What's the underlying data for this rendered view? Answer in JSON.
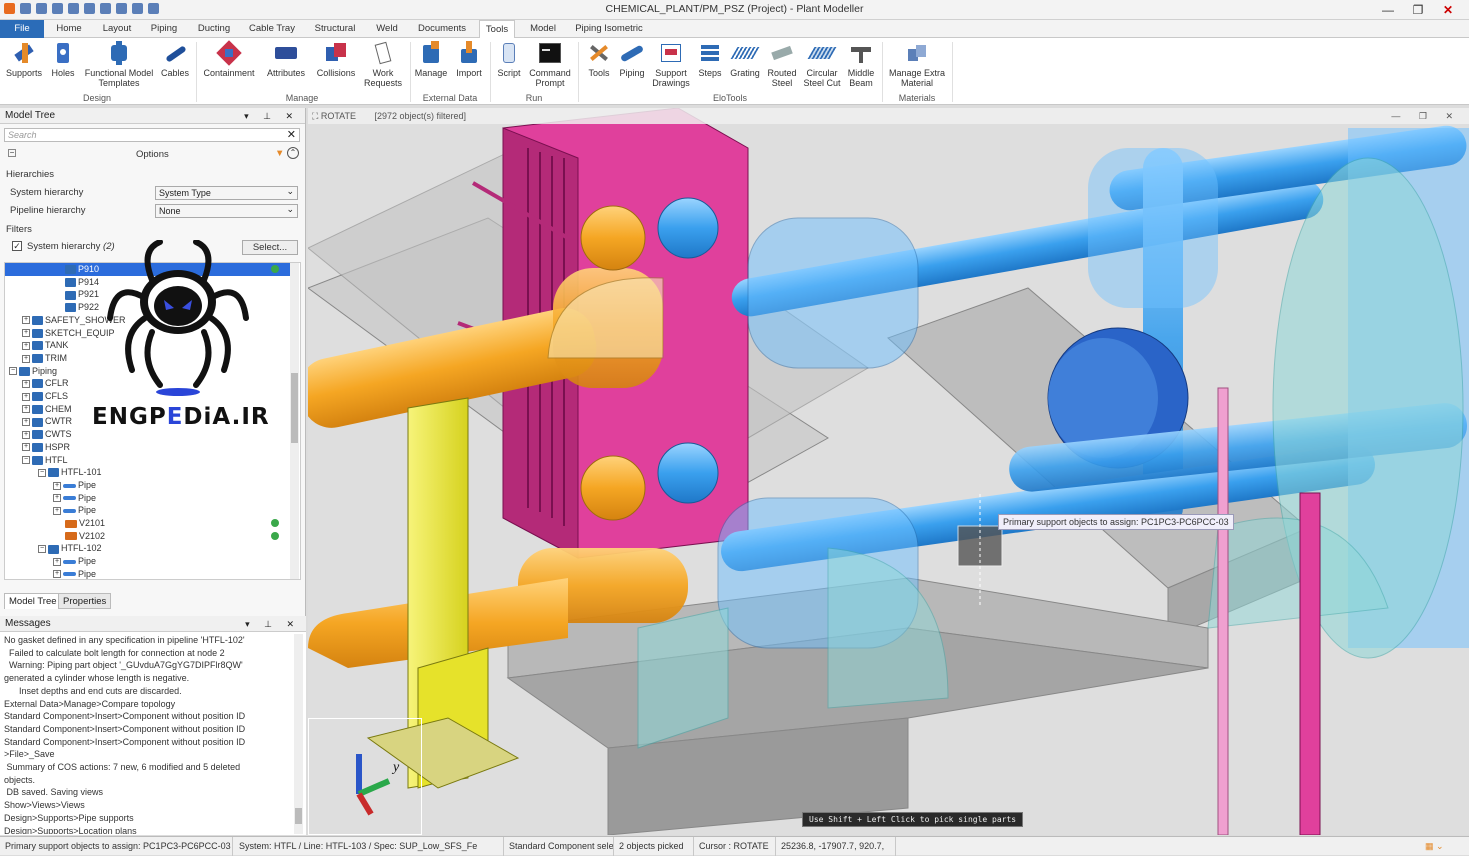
{
  "window": {
    "title": "CHEMICAL_PLANT/PM_PSZ (Project) - Plant Modeller"
  },
  "tabs": [
    "File",
    "Home",
    "Layout",
    "Piping",
    "Ducting",
    "Cable Tray",
    "Structural",
    "Weld",
    "Documents",
    "Tools",
    "Model",
    "Piping Isometric"
  ],
  "active_tab": "Tools",
  "ribbon": {
    "design": {
      "group": "Design",
      "buttons": [
        "Supports",
        "Holes",
        "Functional Model Templates",
        "Cables"
      ]
    },
    "manage": {
      "group": "Manage",
      "buttons": [
        "Containment",
        "Attributes",
        "Collisions",
        "Work Requests"
      ]
    },
    "external": {
      "group": "External Data",
      "buttons": [
        "Manage",
        "Import"
      ]
    },
    "run": {
      "group": "Run",
      "buttons": [
        "Script",
        "Command Prompt"
      ]
    },
    "elotools": {
      "group": "EloTools",
      "buttons": [
        "Tools",
        "Piping",
        "Support Drawings",
        "Steps",
        "Grating",
        "Routed Steel",
        "Circular Steel Cut",
        "Middle Beam"
      ]
    },
    "materials": {
      "group": "Materials",
      "buttons": [
        "Manage Extra Material"
      ]
    }
  },
  "model_tree": {
    "title": "Model Tree",
    "search_placeholder": "Search",
    "options_label": "Options",
    "hierarchies_label": "Hierarchies",
    "system_hierarchy_label": "System hierarchy",
    "system_hierarchy_value": "System Type",
    "pipeline_hierarchy_label": "Pipeline hierarchy",
    "pipeline_hierarchy_value": "None",
    "filters_label": "Filters",
    "filter_checkbox_label": "System hierarchy",
    "filter_count": "(2)",
    "select_button": "Select...",
    "nodes": [
      {
        "label": "P910",
        "level": 4,
        "selected": true,
        "status": true
      },
      {
        "label": "P914",
        "level": 4
      },
      {
        "label": "P921",
        "level": 4
      },
      {
        "label": "P922",
        "level": 4
      },
      {
        "label": "SAFETY_SHOWER",
        "level": 2,
        "expander": "+"
      },
      {
        "label": "SKETCH_EQUIP",
        "level": 2,
        "expander": "+"
      },
      {
        "label": "TANK",
        "level": 2,
        "expander": "+"
      },
      {
        "label": "TRIM",
        "level": 2,
        "expander": "+"
      },
      {
        "label": "Piping",
        "level": 1,
        "expander": "-"
      },
      {
        "label": "CFLR",
        "level": 2,
        "expander": "+"
      },
      {
        "label": "CFLS",
        "level": 2,
        "expander": "+"
      },
      {
        "label": "CHEM",
        "level": 2,
        "expander": "+"
      },
      {
        "label": "CWTR",
        "level": 2,
        "expander": "+"
      },
      {
        "label": "CWTS",
        "level": 2,
        "expander": "+"
      },
      {
        "label": "HSPR",
        "level": 2,
        "expander": "+"
      },
      {
        "label": "HTFL",
        "level": 2,
        "expander": "-"
      },
      {
        "label": "HTFL-101",
        "level": 3,
        "expander": "-"
      },
      {
        "label": "Pipe",
        "level": 4,
        "expander": "+",
        "kind": "pipe"
      },
      {
        "label": "Pipe",
        "level": 4,
        "expander": "+",
        "kind": "pipe"
      },
      {
        "label": "Pipe",
        "level": 4,
        "expander": "+",
        "kind": "pipe"
      },
      {
        "label": "V2101",
        "level": 4,
        "kind": "valve",
        "status": true
      },
      {
        "label": "V2102",
        "level": 4,
        "kind": "valve",
        "status": true
      },
      {
        "label": "HTFL-102",
        "level": 3,
        "expander": "-"
      },
      {
        "label": "Pipe",
        "level": 4,
        "expander": "+",
        "kind": "pipe"
      },
      {
        "label": "Pipe",
        "level": 4,
        "expander": "+",
        "kind": "pipe"
      }
    ],
    "bottom_tabs": [
      "Model Tree",
      "Properties"
    ]
  },
  "messages": {
    "title": "Messages",
    "lines": [
      "No gasket defined in any specification in pipeline 'HTFL-102'",
      "  Failed to calculate bolt length for connection at node 2",
      "  Warning: Piping part object '_GUvduA7GgYG7DIPFlr8QW'",
      "generated a cylinder whose length is negative.",
      "      Inset depths and end cuts are discarded.",
      "External Data>Manage>Compare topology",
      "Standard Component>Insert>Component without position ID",
      "Standard Component>Insert>Component without position ID",
      "Standard Component>Insert>Component without position ID",
      ">File>_Save",
      " Summary of COS actions: 7 new, 6 modified and 5 deleted",
      "objects.",
      " DB saved. Saving views",
      "Show>Views>Views",
      "Design>Supports>Pipe supports",
      "Design>Supports>Location plans"
    ]
  },
  "viewport": {
    "mode": "ROTATE",
    "filter_info": "[2972 object(s) filtered]",
    "tooltip": "Primary support objects to assign: PC1PC3-PC6PCC-03",
    "hint": "Use Shift + Left Click to pick single parts"
  },
  "watermark": {
    "text_a": "ENGP",
    "text_e": "E",
    "text_b": "DiA.IR"
  },
  "statusbar": [
    "Primary support objects to assign: PC1PC3-PC6PCC-03",
    "System: HTFL / Line: HTFL-103 / Spec: SUP_Low_SFS_Fe",
    "Standard Component selected",
    "2 objects picked",
    "Cursor : ROTATE",
    "25236.8, -17907.7, 920.7,"
  ],
  "colors": {
    "accent": "#2b6cb8",
    "selection": "#2b6cdc",
    "pipe_blue": "#3aa0ee",
    "pipe_orange": "#f5a623",
    "exchanger_pink": "#e0409c",
    "steel_yellow": "#eeea3a"
  }
}
